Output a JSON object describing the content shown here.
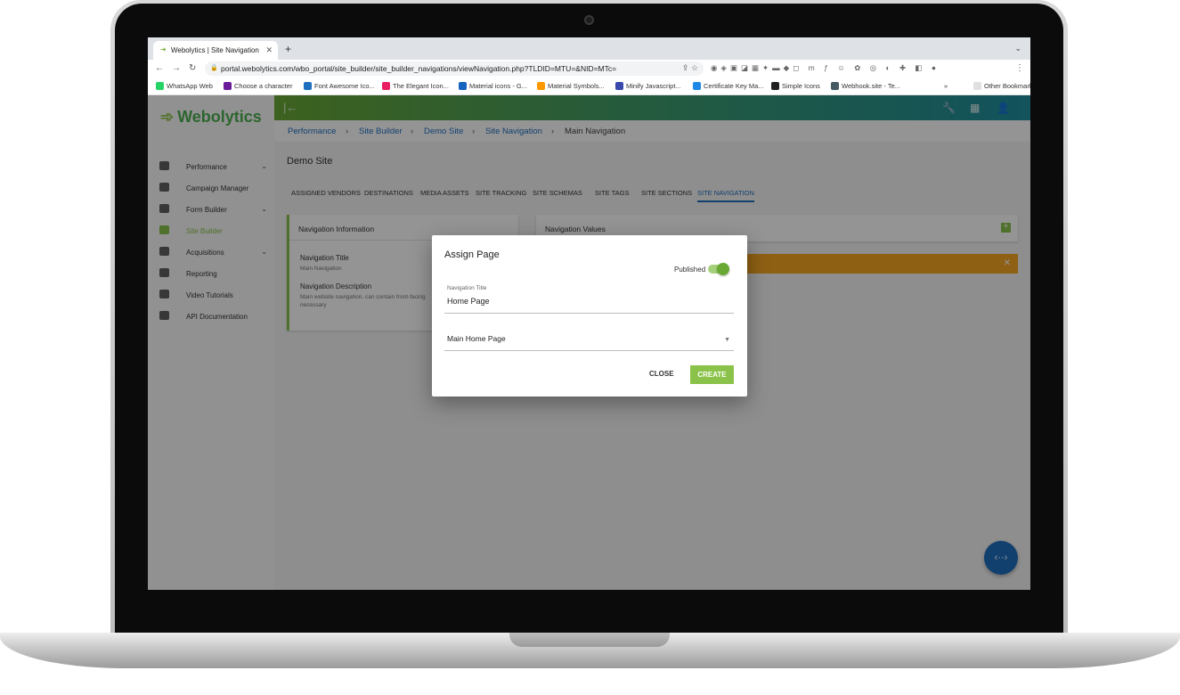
{
  "browser": {
    "tab_title": "Webolytics | Site Navigation",
    "url": "portal.webolytics.com/wbo_portal/site_builder/site_builder_navigations/viewNavigation.php?TLDID=MTU=&NID=MTc=",
    "bookmarks": [
      {
        "label": "WhatsApp Web",
        "color": "#25d366"
      },
      {
        "label": "Choose a character",
        "color": "#6a1b9a"
      },
      {
        "label": "Font Awesome Ico...",
        "color": "#1e6fc0"
      },
      {
        "label": "The Elegant Icon...",
        "color": "#e91e63"
      },
      {
        "label": "Material icons - G...",
        "color": "#1565c0"
      },
      {
        "label": "Material Symbols...",
        "color": "#ff9800"
      },
      {
        "label": "Minify Javascript...",
        "color": "#3949ab"
      },
      {
        "label": "Certificate Key Ma...",
        "color": "#1e88e5"
      },
      {
        "label": "Simple Icons",
        "color": "#212121"
      },
      {
        "label": "Webhook.site - Te...",
        "color": "#455a64"
      }
    ],
    "bookmarks_more": "»",
    "other_bookmarks": "Other Bookmarks"
  },
  "app": {
    "brand": "Webolytics",
    "brand_color": "#4caf50",
    "accent_color": "#8bc34a",
    "link_color": "#1e6fc0",
    "sidebar": [
      {
        "label": "Performance",
        "icon": "dashboard-icon",
        "expandable": true
      },
      {
        "label": "Campaign Manager",
        "icon": "trend-icon",
        "expandable": false
      },
      {
        "label": "Form Builder",
        "icon": "form-icon",
        "expandable": true
      },
      {
        "label": "Site Builder",
        "icon": "web-icon",
        "expandable": false,
        "active": true
      },
      {
        "label": "Acquisitions",
        "icon": "people-icon",
        "expandable": true
      },
      {
        "label": "Reporting",
        "icon": "report-icon",
        "expandable": false
      },
      {
        "label": "Video Tutorials",
        "icon": "video-icon",
        "expandable": false
      },
      {
        "label": "API Documentation",
        "icon": "book-icon",
        "expandable": false
      }
    ],
    "breadcrumbs": [
      "Performance",
      "Site Builder",
      "Demo Site",
      "Site Navigation"
    ],
    "breadcrumb_current": "Main Navigation",
    "page_title": "Demo Site",
    "tabs": [
      "ASSIGNED VENDORS",
      "DESTINATIONS",
      "MEDIA ASSETS",
      "SITE TRACKING",
      "SITE SCHEMAS",
      "SITE TAGS",
      "SITE SECTIONS",
      "SITE NAVIGATION"
    ],
    "active_tab": "SITE NAVIGATION",
    "nav_info": {
      "heading": "Navigation Information",
      "title_label": "Navigation Title",
      "title_value": "Main Navigation",
      "desc_label": "Navigation Description",
      "desc_value": "Main website navigation.  can contain front-facing"
    },
    "nav_values_heading": "Navigation Values",
    "nav_values_desc_tail": "necessary",
    "alert_color": "#f5a623"
  },
  "modal": {
    "title": "Assign Page",
    "published_label": "Published",
    "published": true,
    "nav_title_label": "Navigation Title",
    "nav_title_value": "Home Page",
    "page_select_value": "Main Home Page",
    "close_label": "CLOSE",
    "create_label": "CREATE"
  }
}
